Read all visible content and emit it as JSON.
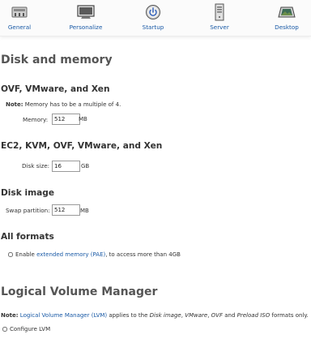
{
  "toolbar": {
    "items": [
      {
        "label": "General",
        "icon": "control-panel-icon"
      },
      {
        "label": "Personalize",
        "icon": "monitor-icon"
      },
      {
        "label": "Startup",
        "icon": "power-icon"
      },
      {
        "label": "Server",
        "icon": "server-tower-icon"
      },
      {
        "label": "Desktop",
        "icon": "desktop-landscape-icon"
      }
    ]
  },
  "disk_memory": {
    "title": "Disk and memory",
    "ovf_section": {
      "heading": "OVF, VMware, and Xen",
      "note_label": "Note:",
      "note_text": "Memory has to be a multiple of 4.",
      "memory_label": "Memory:",
      "memory_value": "512",
      "memory_unit": "MB"
    },
    "ec2_section": {
      "heading": "EC2, KVM, OVF, VMware, and Xen",
      "disk_label": "Disk size:",
      "disk_value": "16",
      "disk_unit": "GB"
    },
    "disk_image": {
      "heading": "Disk image",
      "swap_label": "Swap partition:",
      "swap_value": "512",
      "swap_unit": "MB"
    },
    "all_formats": {
      "heading": "All formats",
      "pae_prefix": "Enable",
      "pae_link": "extended memory (PAE)",
      "pae_suffix": ", to access more than 4GB",
      "pae_checked": false
    }
  },
  "lvm": {
    "title": "Logical Volume Manager",
    "note_label": "Note:",
    "note_link": "Logical Volume Manager (LVM)",
    "note_mid": "applies to the",
    "fmt1": "Disk image",
    "sep1": ",",
    "fmt2": "VMware",
    "sep2": ",",
    "fmt3": "OVF",
    "and_text": "and",
    "fmt4": "Preload ISO",
    "note_end": "formats only.",
    "configure_label": "Configure LVM",
    "configure_checked": false
  },
  "colors": {
    "link": "#1a5aa6",
    "heading": "#555555"
  }
}
